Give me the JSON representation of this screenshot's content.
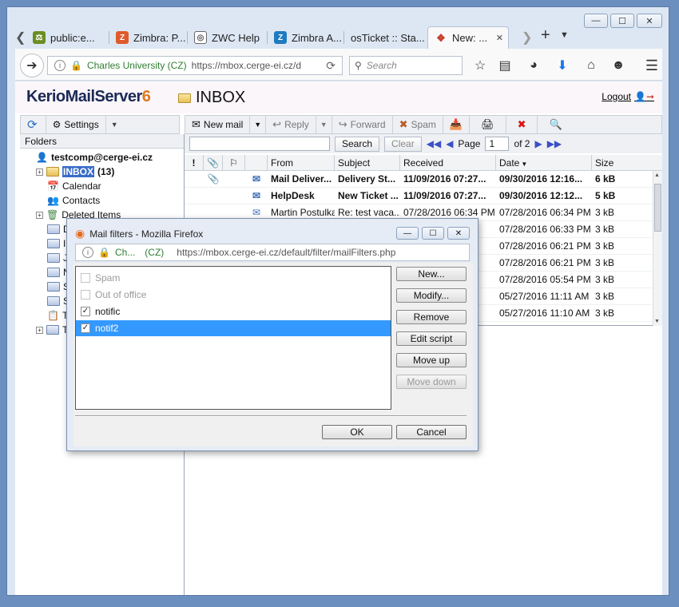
{
  "browser": {
    "tabs": [
      {
        "title": "public:e...",
        "icon": "scale-icon",
        "color": "#6b8e23"
      },
      {
        "title": "Zimbra: P...",
        "icon": "zimbra-icon",
        "color": "#e05a2b"
      },
      {
        "title": "ZWC Help",
        "icon": "help-icon",
        "color": "#666666"
      },
      {
        "title": "Zimbra A...",
        "icon": "zimbra-icon",
        "color": "#1f7bc0"
      },
      {
        "title": "osTicket :: Sta...",
        "icon": "ticket-icon",
        "color": "#999999"
      },
      {
        "title": "New: ...",
        "icon": "kerio-icon",
        "color": "#c73a2a"
      }
    ],
    "url": {
      "owner": "Charles University (CZ)",
      "text": "https://mbox.cerge-ei.cz/d"
    },
    "search_placeholder": "Search"
  },
  "app": {
    "logo_prefix": "KerioMailServer",
    "logo_suffix": "6",
    "folder_title": "INBOX",
    "logout": "Logout"
  },
  "left_toolbar": {
    "settings": "Settings"
  },
  "folders": {
    "header": "Folders",
    "account": "testcomp@cerge-ei.cz",
    "items": [
      {
        "label": "INBOX",
        "count": "(13)"
      },
      {
        "label": "Calendar"
      },
      {
        "label": "Contacts"
      },
      {
        "label": "Deleted Items"
      },
      {
        "label": "Dra"
      },
      {
        "label": "Inf"
      },
      {
        "label": "Jun"
      },
      {
        "label": "Not"
      },
      {
        "label": "Ser"
      },
      {
        "label": "Ser"
      },
      {
        "label": "Tas"
      },
      {
        "label": "Tra"
      }
    ]
  },
  "toolbar": {
    "new_mail": "New mail",
    "reply": "Reply",
    "forward": "Forward",
    "spam": "Spam"
  },
  "search": {
    "search_btn": "Search",
    "clear_btn": "Clear",
    "page_label": "Page",
    "page_value": "1",
    "of_label": "of 2"
  },
  "mail": {
    "columns": [
      "!",
      "",
      "",
      "",
      "From",
      "Subject",
      "Received",
      "Date",
      "Size"
    ],
    "rows": [
      {
        "from": "Mail Deliver...",
        "subject": "Delivery St...",
        "received": "11/09/2016 07:27...",
        "date": "09/30/2016 12:16...",
        "size": "6 kB",
        "unread": true,
        "attachment": true,
        "icon": "envelope-icon"
      },
      {
        "from": "HelpDesk",
        "subject": "New Ticket ...",
        "received": "11/09/2016 07:27...",
        "date": "09/30/2016 12:12...",
        "size": "5 kB",
        "unread": true,
        "attachment": false,
        "icon": "envelope-icon"
      },
      {
        "from": "Martin Postulka",
        "subject": "Re: test vaca...",
        "received": "07/28/2016 06:34 PM",
        "date": "07/28/2016 06:34 PM",
        "size": "3 kB",
        "unread": false,
        "attachment": false,
        "icon": "envelope-open-icon"
      },
      {
        "from": "",
        "subject": "",
        "received": "",
        "date": "07/28/2016 06:33 PM",
        "size": "3 kB",
        "unread": false
      },
      {
        "from": "",
        "subject": "",
        "received": "",
        "date": "07/28/2016 06:21 PM",
        "size": "3 kB",
        "unread": false
      },
      {
        "from": "",
        "subject": "",
        "received": "",
        "date": "07/28/2016 06:21 PM",
        "size": "3 kB",
        "unread": false
      },
      {
        "from": "",
        "subject": "",
        "received": "",
        "date": "07/28/2016 05:54 PM",
        "size": "3 kB",
        "unread": false
      },
      {
        "from": "",
        "subject": "",
        "received": "",
        "date": "05/27/2016 11:11 AM",
        "size": "3 kB",
        "unread": false
      },
      {
        "from": "",
        "subject": "",
        "received": "",
        "date": "05/27/2016 11:10 AM",
        "size": "3 kB",
        "unread": false
      }
    ]
  },
  "dialog": {
    "title": "Mail filters - Mozilla Firefox",
    "url_owner": "Ch...",
    "url_owner_cc": "(CZ)",
    "url": "https://mbox.cerge-ei.cz/default/filter/mailFilters.php",
    "filters": [
      {
        "label": "Spam",
        "checked": false,
        "disabled": true,
        "selected": false
      },
      {
        "label": "Out of office",
        "checked": false,
        "disabled": true,
        "selected": false
      },
      {
        "label": "notific",
        "checked": true,
        "disabled": false,
        "selected": false
      },
      {
        "label": "notif2",
        "checked": true,
        "disabled": false,
        "selected": true
      }
    ],
    "buttons": {
      "new": "New...",
      "modify": "Modify...",
      "remove": "Remove",
      "edit_script": "Edit script",
      "move_up": "Move up",
      "move_down": "Move down",
      "ok": "OK",
      "cancel": "Cancel"
    }
  }
}
